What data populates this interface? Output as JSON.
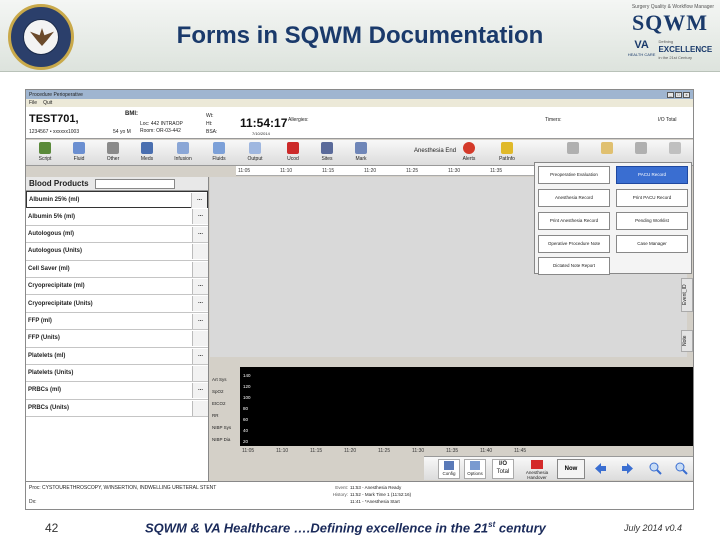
{
  "slide": {
    "title": "Forms in SQWM Documentation",
    "page_number": "42",
    "footer_text": "SQWM & VA Healthcare ….Defining excellence in the 21",
    "footer_sup": "st",
    "footer_tail": " century",
    "footer_date": "July 2014 v0.4"
  },
  "brand": {
    "top_line": "Surgery Quality & Workflow Manager",
    "name": "SQWM",
    "va": "VA",
    "va_sub": "HEALTH CARE",
    "excellence_pre": "Defining",
    "excellence": "EXCELLENCE",
    "excellence_post": "in the 21st Century"
  },
  "window": {
    "title": "Procedure Perioperative",
    "menu": [
      "File",
      "Quit"
    ],
    "buttons": [
      "_",
      "□",
      "x"
    ]
  },
  "patient": {
    "name": "TEST701,",
    "id_line": "1234567 • xxxxxx1003",
    "age": "54 yo M",
    "bmi": "BMI:",
    "loc1": "Loc: 442 INTRAOP",
    "loc2": "Room: OR-03-442",
    "wt": "Wt:",
    "ht": "Ht:",
    "bsa": "BSA:",
    "time": "11:54:17",
    "date": "7/10/2014",
    "allergies": "Allergies:",
    "timers": "Timers:",
    "io_total": "I/O Total"
  },
  "toolbar": {
    "tools": [
      "Script",
      "Fluid",
      "Other",
      "Meds",
      "Infusion",
      "Fluids",
      "Output",
      "Ucod",
      "Sites",
      "Mark"
    ],
    "anesthesia_end": "Anesthesia End",
    "alerts": "Alerts",
    "pat_info": "PatInfo"
  },
  "timeline": {
    "ticks": [
      "11:05",
      "11:10",
      "11:15",
      "11:20",
      "11:25",
      "11:30",
      "11:35"
    ]
  },
  "blood_products": {
    "title": "Blood Products",
    "rows": [
      "Albumin 25% (ml)",
      "Albumin 5% (ml)",
      "Autologous (ml)",
      "Autologous (Units)",
      "Cell Saver (ml)",
      "Cryoprecipitate (ml)",
      "Cryoprecipitate (Units)",
      "FFP (ml)",
      "FFP (Units)",
      "Platelets (ml)",
      "Platelets (Units)",
      "PRBCs (ml)",
      "PRBCs (Units)"
    ],
    "dots": "..."
  },
  "forms_menu": {
    "items": [
      {
        "label": "Preoperative Evaluation",
        "active": false
      },
      {
        "label": "PACU Record",
        "active": true
      },
      {
        "label": "Anesthesia Record",
        "active": false
      },
      {
        "label": "Print PACU Record",
        "active": false
      },
      {
        "label": "Print Anesthesia Record",
        "active": false
      },
      {
        "label": "Pending Worklist",
        "active": false
      },
      {
        "label": "Operative Procedure Note",
        "active": false
      },
      {
        "label": "Case Manager",
        "active": false
      },
      {
        "label": "Dictated Note Report",
        "active": false
      }
    ]
  },
  "side_tabs": [
    "Event_ID",
    "Note"
  ],
  "vitals": {
    "labels": [
      "Art Sys",
      "SpO2",
      "EtCO2",
      "RR",
      "NIBP Sys",
      "NIBP Dia"
    ],
    "scale": [
      "140",
      "120",
      "100",
      "80",
      "60",
      "40",
      "20"
    ],
    "axis_ticks": [
      "11:05",
      "11:10",
      "11:15",
      "11:20",
      "11:25",
      "11:30",
      "11:35",
      "11:40",
      "11:45"
    ]
  },
  "bottom_bar": {
    "config": "Config",
    "options": "Options",
    "io": "I/O",
    "total": "Total",
    "anesthesia_handover": "Anesthesia Handover",
    "now": "Now"
  },
  "footer": {
    "proc": "Proc: CYSTOURETHROSCOPY, W/INSERTION, INDWELLING URETERAL STENT",
    "dx": "Dx:",
    "event_label": "Event:",
    "history_label": "History:",
    "events": [
      "11:53 - Anesthesia Ready",
      "11:52 - Mark Time 1 (11:52:16)",
      "11:41 - *Anesthesia Start"
    ]
  },
  "colors": {
    "title": "#1a3a6b",
    "accent": "#3a6ed1",
    "chart_bg": "#000000"
  }
}
